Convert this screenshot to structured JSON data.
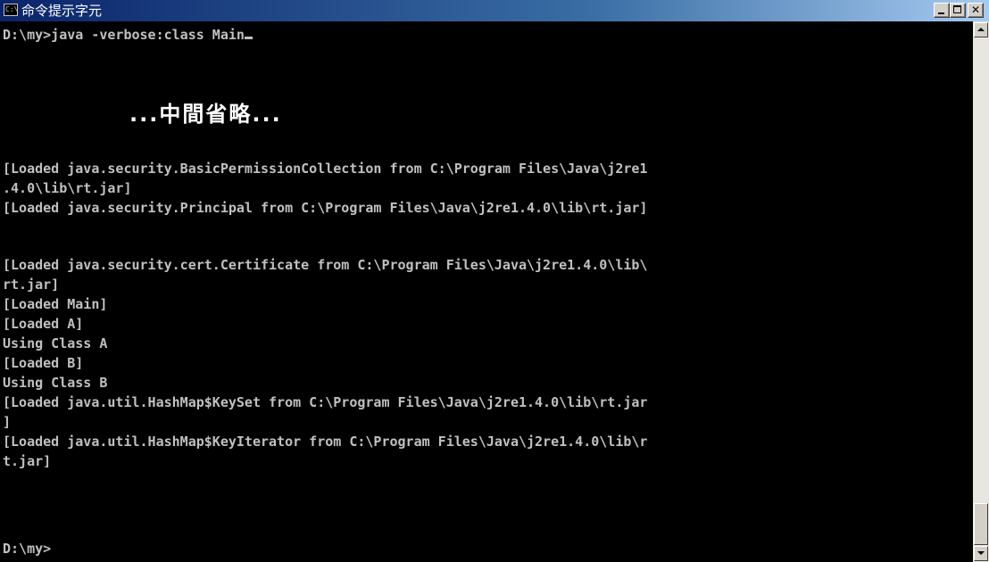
{
  "window": {
    "title": "命令提示字元",
    "icon": "cmd-window-icon",
    "icon_glyph": "C:\\",
    "controls": {
      "minimize_icon": "minimize-icon",
      "maximize_icon": "maximize-icon",
      "close_icon": "close-icon",
      "close_glyph": "✕"
    }
  },
  "console": {
    "text_color": "#c0c0c0",
    "background": "#000000",
    "command_line": "D:\\my>java -verbose:class Main",
    "omitted_note": "...中間省略...",
    "lines": [
      "[Loaded java.security.BasicPermissionCollection from C:\\Program Files\\Java\\j2re1",
      ".4.0\\lib\\rt.jar]",
      "[Loaded java.security.Principal from C:\\Program Files\\Java\\j2re1.4.0\\lib\\rt.jar]",
      "",
      "[Loaded java.security.cert.Certificate from C:\\Program Files\\Java\\j2re1.4.0\\lib\\",
      "rt.jar]",
      "[Loaded Main]",
      "[Loaded A]",
      "Using Class A",
      "[Loaded B]",
      "Using Class B",
      "[Loaded java.util.HashMap$KeySet from C:\\Program Files\\Java\\j2re1.4.0\\lib\\rt.jar",
      "]",
      "[Loaded java.util.HashMap$KeyIterator from C:\\Program Files\\Java\\j2re1.4.0\\lib\\r",
      "t.jar]",
      ""
    ],
    "prompt": "D:\\my>"
  },
  "scrollbar": {
    "up_icon": "scroll-up-arrow-icon",
    "down_icon": "scroll-down-arrow-icon",
    "position_fraction": 1.0
  }
}
